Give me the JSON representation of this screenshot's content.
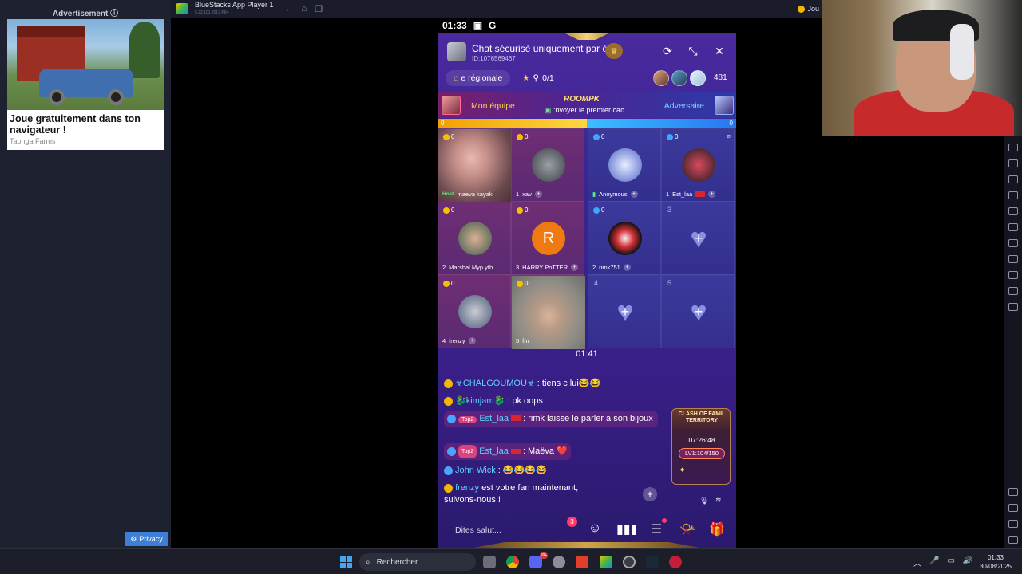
{
  "ad": {
    "header": "Advertisement",
    "title": "Joue gratuitement dans ton navigateur !",
    "brand": "Taonga Farms",
    "privacy": "Privacy"
  },
  "bluestacks": {
    "title": "BlueStacks App Player 1",
    "version": "5.22.101.2017 P64",
    "right_label": "Jou"
  },
  "phone_status": {
    "time": "01:33"
  },
  "room": {
    "title": "Chat sécurisé uniquement par é",
    "id": "ID:1076569467",
    "region": "е régionale",
    "stars": "0/1",
    "viewer_count": "481"
  },
  "pk": {
    "my_team": "Mon équipe",
    "opponent": "Adversaire",
    "logo": "ROOMPK",
    "message": ":nvoyer le premier cac",
    "score_left": "0",
    "score_right": "0",
    "left_share": 0.5
  },
  "seats": [
    {
      "coins": "0",
      "prefix": "Host",
      "name": "maeva kayak"
    },
    {
      "coins": "0",
      "prefix": "1",
      "name": "xav"
    },
    {
      "coins": "0",
      "prefix": "",
      "name": "Anoymous"
    },
    {
      "coins": "0",
      "prefix": "1",
      "name": "Est_laa"
    },
    {
      "coins": "0",
      "prefix": "2",
      "name": "Marshal Myp ytb"
    },
    {
      "coins": "0",
      "prefix": "3",
      "name": "HARRY PoTTER",
      "initial": "R"
    },
    {
      "coins": "0",
      "prefix": "2",
      "name": "rimk751"
    },
    {
      "number": "3"
    },
    {
      "coins": "0",
      "prefix": "4",
      "name": "frenzy"
    },
    {
      "coins": "0",
      "prefix": "5",
      "name": "fm"
    },
    {
      "number": "4"
    },
    {
      "number": "5"
    }
  ],
  "timer": "01:41",
  "chat": [
    {
      "user": "☣CHALGOUMOU☣",
      "text": ": tiens c lui😂😂"
    },
    {
      "user": "🐉kimjam🐉",
      "text": ": pk oops"
    },
    {
      "badge": "Top2",
      "user": "Est_laa",
      "text": ": rimk laisse le parler a son bijoux"
    },
    {
      "badge": "Top2",
      "user": "Est_laa",
      "text": ": Maëva ❤️"
    },
    {
      "user": "John Wick",
      "text": ": 😂😂😂😂"
    },
    {
      "user": "frenzy",
      "text": " est votre fan maintenant, suivons-nous !"
    }
  ],
  "clash": {
    "title": "CLASH OF FAMIL TERRITORY",
    "time": "07:26:48",
    "level": "LV1:104/150"
  },
  "input": {
    "placeholder": "Dites salut...",
    "notif_count": "3"
  },
  "taskbar": {
    "search": "Rechercher",
    "time": "01:33",
    "date": "30/08/2025",
    "badge": "99+"
  }
}
